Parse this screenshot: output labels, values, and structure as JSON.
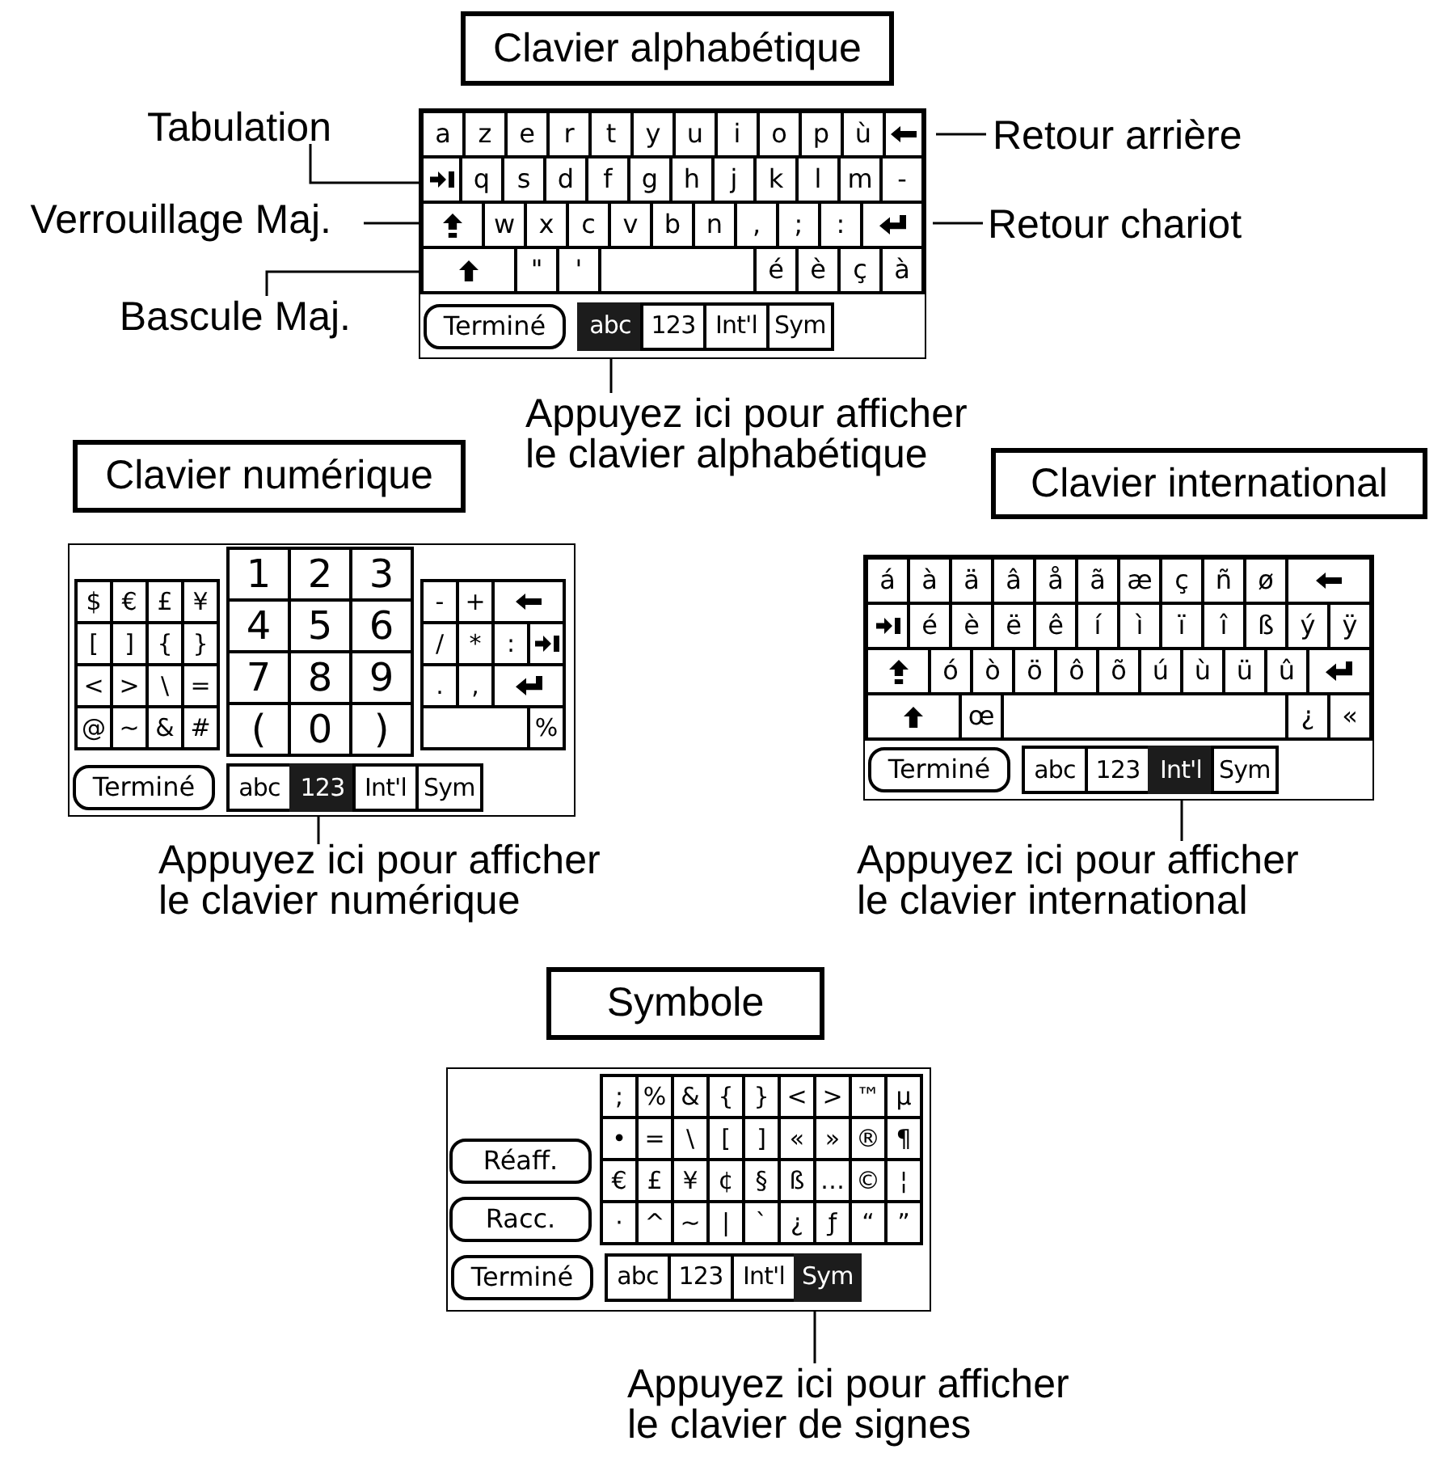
{
  "alphabetic": {
    "title": "Clavier alphabétique",
    "callouts": [
      "Tabulation",
      "Verrouillage Maj.",
      "Bascule Maj.",
      "Retour arrière",
      "Retour chariot"
    ],
    "keyboard": {
      "rows": [
        {
          "keys": [
            {
              "kind": "char",
              "label": "a"
            },
            {
              "kind": "char",
              "label": "z"
            },
            {
              "kind": "char",
              "label": "e"
            },
            {
              "kind": "char",
              "label": "r"
            },
            {
              "kind": "char",
              "label": "t"
            },
            {
              "kind": "char",
              "label": "y"
            },
            {
              "kind": "char",
              "label": "u"
            },
            {
              "kind": "char",
              "label": "i"
            },
            {
              "kind": "char",
              "label": "o"
            },
            {
              "kind": "char",
              "label": "p"
            },
            {
              "kind": "char",
              "label": "ù"
            },
            {
              "kind": "backspace"
            }
          ]
        },
        {
          "keys": [
            {
              "kind": "tab"
            },
            {
              "kind": "char",
              "label": "q"
            },
            {
              "kind": "char",
              "label": "s"
            },
            {
              "kind": "char",
              "label": "d"
            },
            {
              "kind": "char",
              "label": "f"
            },
            {
              "kind": "char",
              "label": "g"
            },
            {
              "kind": "char",
              "label": "h"
            },
            {
              "kind": "char",
              "label": "j"
            },
            {
              "kind": "char",
              "label": "k"
            },
            {
              "kind": "char",
              "label": "l"
            },
            {
              "kind": "char",
              "label": "m"
            },
            {
              "kind": "char",
              "label": "-"
            }
          ]
        },
        {
          "keys": [
            {
              "kind": "capslock"
            },
            {
              "kind": "char",
              "label": "w"
            },
            {
              "kind": "char",
              "label": "x"
            },
            {
              "kind": "char",
              "label": "c"
            },
            {
              "kind": "char",
              "label": "v"
            },
            {
              "kind": "char",
              "label": "b"
            },
            {
              "kind": "char",
              "label": "n"
            },
            {
              "kind": "char",
              "label": ","
            },
            {
              "kind": "char",
              "label": ";"
            },
            {
              "kind": "char",
              "label": ":"
            },
            {
              "kind": "enter"
            }
          ]
        },
        {
          "keys": [
            {
              "kind": "shift"
            },
            {
              "kind": "char",
              "label": "\""
            },
            {
              "kind": "char",
              "label": "'"
            },
            {
              "kind": "space"
            },
            {
              "kind": "char",
              "label": "é"
            },
            {
              "kind": "char",
              "label": "è"
            },
            {
              "kind": "char",
              "label": "ç"
            },
            {
              "kind": "char",
              "label": "à"
            }
          ]
        }
      ],
      "done_button": "Terminé",
      "tabs": [
        {
          "label": "abc",
          "selected": true
        },
        {
          "label": "123",
          "selected": false
        },
        {
          "label": "Int'l",
          "selected": false
        },
        {
          "label": "Sym",
          "selected": false
        }
      ]
    },
    "note": [
      "Appuyez ici pour afficher",
      "le clavier alphabétique"
    ]
  },
  "numeric": {
    "title": "Clavier numérique",
    "keyboard": {
      "groups": [
        {
          "kind": "symbols",
          "rows": [
            {
              "keys": [
                {
                  "kind": "char",
                  "label": "$"
                },
                {
                  "kind": "char",
                  "label": "€"
                },
                {
                  "kind": "char",
                  "label": "£"
                },
                {
                  "kind": "char",
                  "label": "¥"
                }
              ]
            },
            {
              "keys": [
                {
                  "kind": "char",
                  "label": "["
                },
                {
                  "kind": "char",
                  "label": "]"
                },
                {
                  "kind": "char",
                  "label": "{"
                },
                {
                  "kind": "char",
                  "label": "}"
                }
              ]
            },
            {
              "keys": [
                {
                  "kind": "char",
                  "label": "<"
                },
                {
                  "kind": "char",
                  "label": ">"
                },
                {
                  "kind": "char",
                  "label": "\\"
                },
                {
                  "kind": "char",
                  "label": "="
                }
              ]
            },
            {
              "keys": [
                {
                  "kind": "char",
                  "label": "@"
                },
                {
                  "kind": "char",
                  "label": "~"
                },
                {
                  "kind": "char",
                  "label": "&"
                },
                {
                  "kind": "char",
                  "label": "#"
                }
              ]
            }
          ]
        },
        {
          "kind": "digits",
          "rows": [
            {
              "keys": [
                {
                  "kind": "char",
                  "label": "1"
                },
                {
                  "kind": "char",
                  "label": "2"
                },
                {
                  "kind": "char",
                  "label": "3"
                }
              ]
            },
            {
              "keys": [
                {
                  "kind": "char",
                  "label": "4"
                },
                {
                  "kind": "char",
                  "label": "5"
                },
                {
                  "kind": "char",
                  "label": "6"
                }
              ]
            },
            {
              "keys": [
                {
                  "kind": "char",
                  "label": "7"
                },
                {
                  "kind": "char",
                  "label": "8"
                },
                {
                  "kind": "char",
                  "label": "9"
                }
              ]
            },
            {
              "keys": [
                {
                  "kind": "char",
                  "label": "("
                },
                {
                  "kind": "char",
                  "label": "0"
                },
                {
                  "kind": "char",
                  "label": ")"
                }
              ]
            }
          ]
        },
        {
          "kind": "edit",
          "rows": [
            {
              "keys": [
                {
                  "kind": "char",
                  "label": "-"
                },
                {
                  "kind": "char",
                  "label": "+"
                },
                {
                  "kind": "backspace"
                }
              ]
            },
            {
              "keys": [
                {
                  "kind": "char",
                  "label": "/"
                },
                {
                  "kind": "char",
                  "label": "*"
                },
                {
                  "kind": "char",
                  "label": ":"
                },
                {
                  "kind": "tab"
                }
              ]
            },
            {
              "keys": [
                {
                  "kind": "char",
                  "label": "."
                },
                {
                  "kind": "char",
                  "label": ","
                },
                {
                  "kind": "enter"
                }
              ]
            },
            {
              "keys": [
                {
                  "kind": "space"
                },
                {
                  "kind": "char",
                  "label": "%"
                }
              ]
            }
          ]
        }
      ],
      "done_button": "Terminé",
      "tabs": [
        {
          "label": "abc",
          "selected": false
        },
        {
          "label": "123",
          "selected": true
        },
        {
          "label": "Int'l",
          "selected": false
        },
        {
          "label": "Sym",
          "selected": false
        }
      ]
    },
    "note": [
      "Appuyez ici pour afficher",
      "le clavier numérique"
    ]
  },
  "international": {
    "title": "Clavier international",
    "keyboard": {
      "rows": [
        {
          "keys": [
            {
              "kind": "char",
              "label": "á"
            },
            {
              "kind": "char",
              "label": "à"
            },
            {
              "kind": "char",
              "label": "ä"
            },
            {
              "kind": "char",
              "label": "â"
            },
            {
              "kind": "char",
              "label": "å"
            },
            {
              "kind": "char",
              "label": "ã"
            },
            {
              "kind": "char",
              "label": "æ"
            },
            {
              "kind": "char",
              "label": "ç"
            },
            {
              "kind": "char",
              "label": "ñ"
            },
            {
              "kind": "char",
              "label": "ø"
            },
            {
              "kind": "backspace"
            }
          ]
        },
        {
          "keys": [
            {
              "kind": "tab"
            },
            {
              "kind": "char",
              "label": "é"
            },
            {
              "kind": "char",
              "label": "è"
            },
            {
              "kind": "char",
              "label": "ë"
            },
            {
              "kind": "char",
              "label": "ê"
            },
            {
              "kind": "char",
              "label": "í"
            },
            {
              "kind": "char",
              "label": "ì"
            },
            {
              "kind": "char",
              "label": "ï"
            },
            {
              "kind": "char",
              "label": "î"
            },
            {
              "kind": "char",
              "label": "ß"
            },
            {
              "kind": "char",
              "label": "ý"
            },
            {
              "kind": "char",
              "label": "ÿ"
            }
          ]
        },
        {
          "keys": [
            {
              "kind": "capslock"
            },
            {
              "kind": "char",
              "label": "ó"
            },
            {
              "kind": "char",
              "label": "ò"
            },
            {
              "kind": "char",
              "label": "ö"
            },
            {
              "kind": "char",
              "label": "ô"
            },
            {
              "kind": "char",
              "label": "õ"
            },
            {
              "kind": "char",
              "label": "ú"
            },
            {
              "kind": "char",
              "label": "ù"
            },
            {
              "kind": "char",
              "label": "ü"
            },
            {
              "kind": "char",
              "label": "û"
            },
            {
              "kind": "enter"
            }
          ]
        },
        {
          "keys": [
            {
              "kind": "shift"
            },
            {
              "kind": "char",
              "label": "œ"
            },
            {
              "kind": "space"
            },
            {
              "kind": "char",
              "label": "¿"
            },
            {
              "kind": "char",
              "label": "«"
            }
          ]
        }
      ],
      "done_button": "Terminé",
      "tabs": [
        {
          "label": "abc",
          "selected": false
        },
        {
          "label": "123",
          "selected": false
        },
        {
          "label": "Int'l",
          "selected": true
        },
        {
          "label": "Sym",
          "selected": false
        }
      ]
    },
    "note": [
      "Appuyez ici pour afficher",
      "le clavier international"
    ]
  },
  "symbol": {
    "title": "Symbole",
    "keyboard": {
      "side_buttons": [
        "Réaff.",
        "Racc."
      ],
      "rows": [
        {
          "keys": [
            {
              "kind": "char",
              "label": ";"
            },
            {
              "kind": "char",
              "label": "%"
            },
            {
              "kind": "char",
              "label": "&"
            },
            {
              "kind": "char",
              "label": "{"
            },
            {
              "kind": "char",
              "label": "}"
            },
            {
              "kind": "char",
              "label": "<"
            },
            {
              "kind": "char",
              "label": ">"
            },
            {
              "kind": "char",
              "label": "™"
            },
            {
              "kind": "char",
              "label": "µ"
            }
          ]
        },
        {
          "keys": [
            {
              "kind": "char",
              "label": "•"
            },
            {
              "kind": "char",
              "label": "="
            },
            {
              "kind": "char",
              "label": "\\"
            },
            {
              "kind": "char",
              "label": "["
            },
            {
              "kind": "char",
              "label": "]"
            },
            {
              "kind": "char",
              "label": "«"
            },
            {
              "kind": "char",
              "label": "»"
            },
            {
              "kind": "char",
              "label": "®"
            },
            {
              "kind": "char",
              "label": "¶"
            }
          ]
        },
        {
          "keys": [
            {
              "kind": "char",
              "label": "€"
            },
            {
              "kind": "char",
              "label": "£"
            },
            {
              "kind": "char",
              "label": "¥"
            },
            {
              "kind": "char",
              "label": "¢"
            },
            {
              "kind": "char",
              "label": "§"
            },
            {
              "kind": "char",
              "label": "ß"
            },
            {
              "kind": "char",
              "label": "…"
            },
            {
              "kind": "char",
              "label": "©"
            },
            {
              "kind": "char",
              "label": "¦"
            }
          ]
        },
        {
          "keys": [
            {
              "kind": "char",
              "label": "·"
            },
            {
              "kind": "char",
              "label": "^"
            },
            {
              "kind": "char",
              "label": "~"
            },
            {
              "kind": "char",
              "label": "|"
            },
            {
              "kind": "char",
              "label": "`"
            },
            {
              "kind": "char",
              "label": "¿"
            },
            {
              "kind": "char",
              "label": "ƒ"
            },
            {
              "kind": "char",
              "label": "“"
            },
            {
              "kind": "char",
              "label": "”"
            }
          ]
        }
      ],
      "done_button": "Terminé",
      "tabs": [
        {
          "label": "abc",
          "selected": false
        },
        {
          "label": "123",
          "selected": false
        },
        {
          "label": "Int'l",
          "selected": false
        },
        {
          "label": "Sym",
          "selected": true
        }
      ]
    },
    "note": [
      "Appuyez ici pour afficher",
      "le clavier de signes"
    ]
  }
}
